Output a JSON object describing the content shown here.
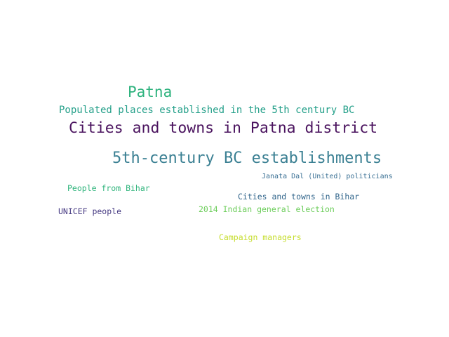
{
  "words": [
    {
      "text": "Patna",
      "color": "#2db27d"
    },
    {
      "text": "Populated places established in the 5th century BC",
      "color": "#25a08a"
    },
    {
      "text": "Cities and towns in Patna district",
      "color": "#4b145f"
    },
    {
      "text": "5th-century BC establishments",
      "color": "#3b8093"
    },
    {
      "text": "Janata Dal (United) politicians",
      "color": "#3a7094"
    },
    {
      "text": "People from Bihar",
      "color": "#2fb47c"
    },
    {
      "text": "Cities and towns in Bihar",
      "color": "#31658b"
    },
    {
      "text": "UNICEF people",
      "color": "#463a82"
    },
    {
      "text": "2014 Indian general election",
      "color": "#6ccd5a"
    },
    {
      "text": "Campaign managers",
      "color": "#c5dd2c"
    }
  ]
}
